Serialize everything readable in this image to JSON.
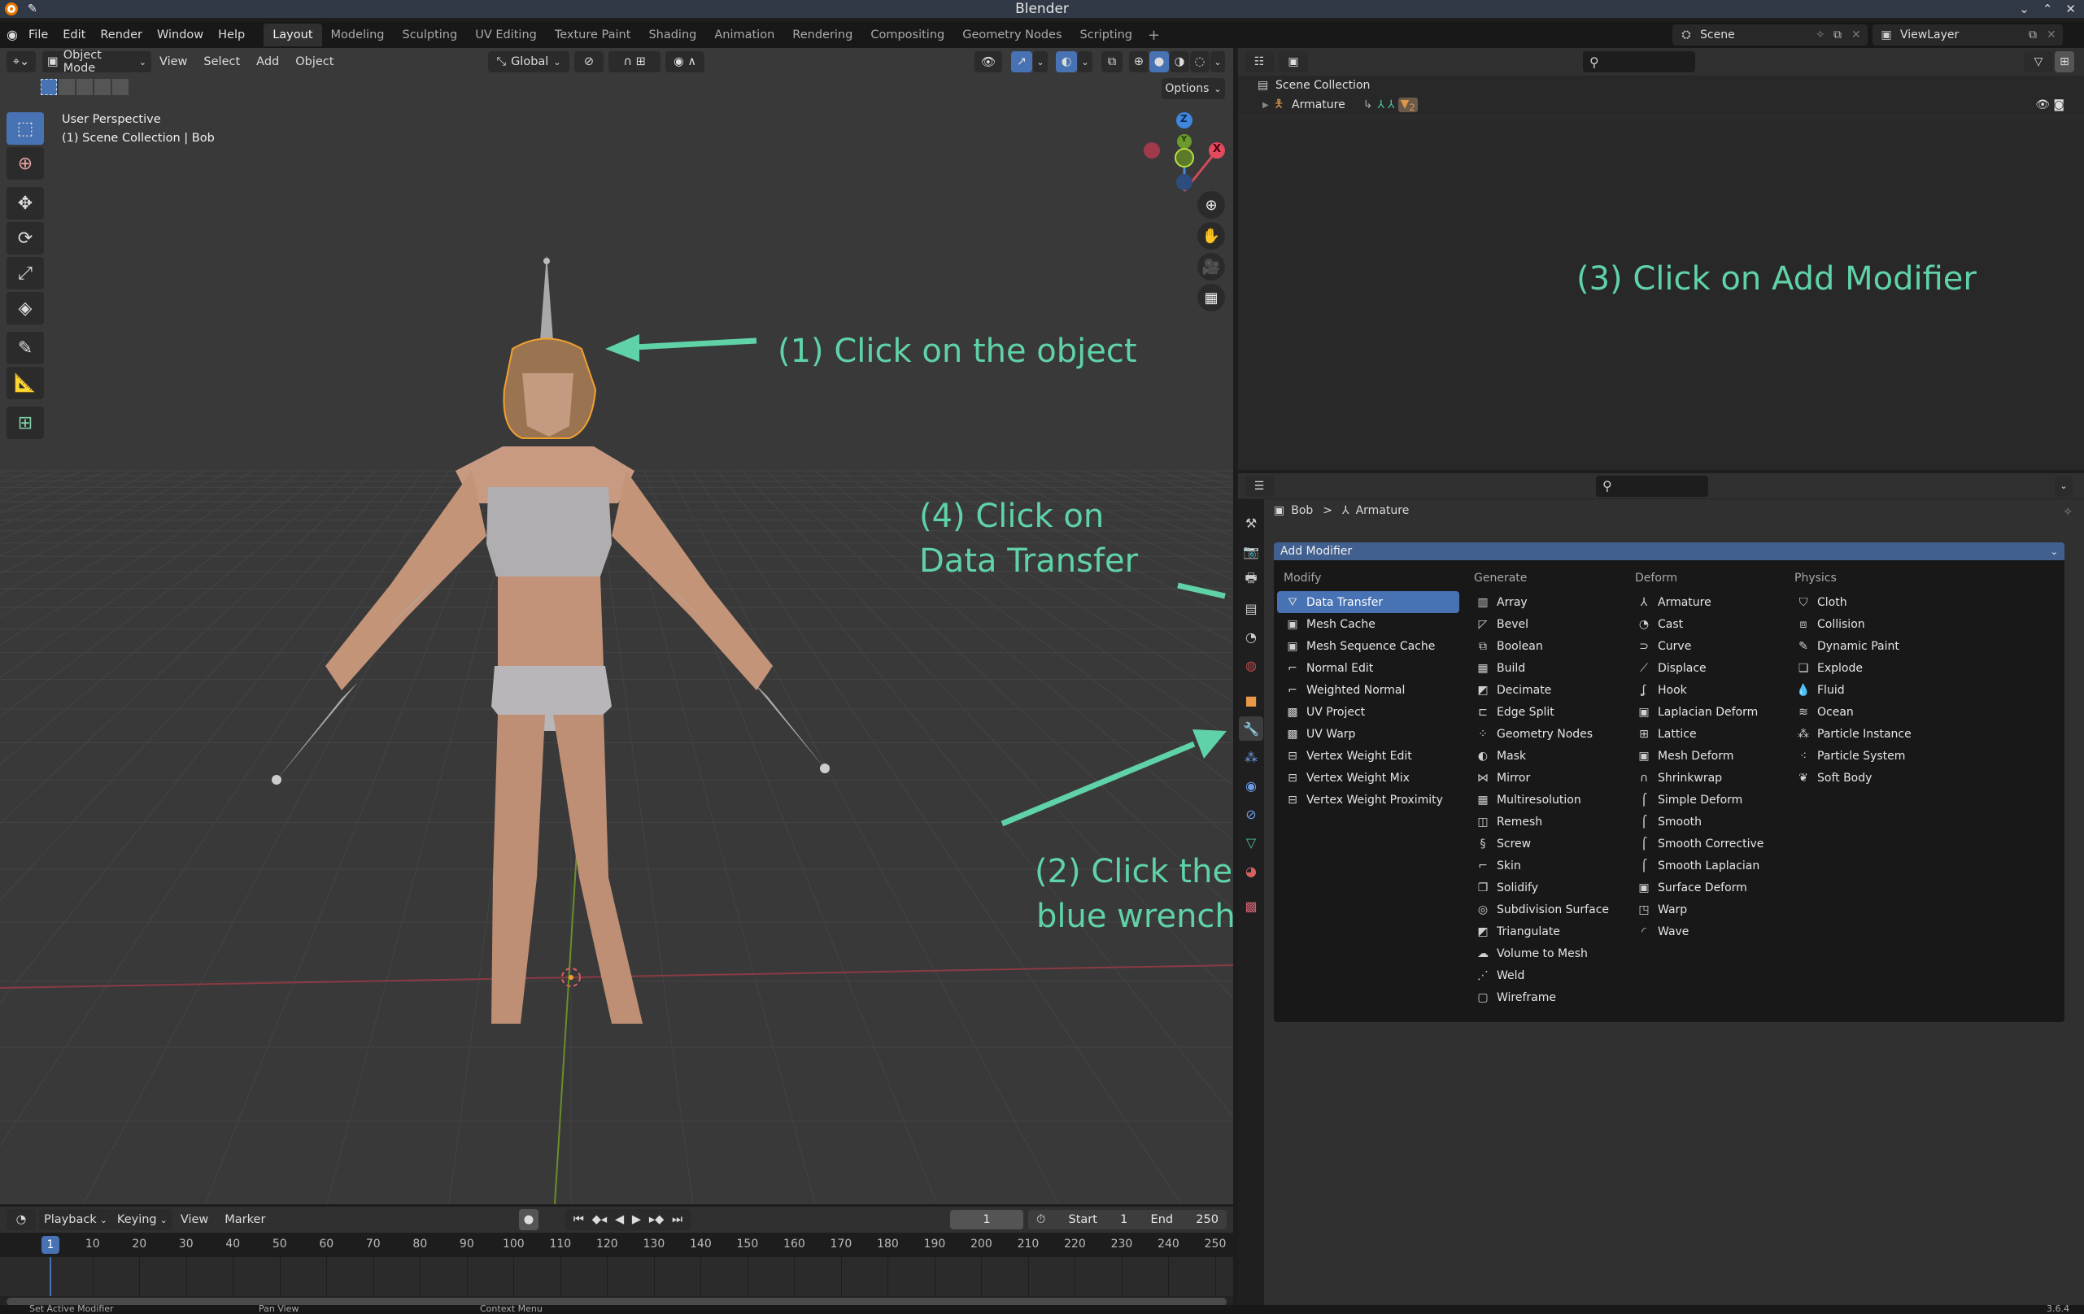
{
  "window": {
    "title": "Blender",
    "controls": [
      "⌄",
      "⌃",
      "✕"
    ]
  },
  "menubar": {
    "menus": [
      "File",
      "Edit",
      "Render",
      "Window",
      "Help"
    ],
    "workspaces": [
      "Layout",
      "Modeling",
      "Sculpting",
      "UV Editing",
      "Texture Paint",
      "Shading",
      "Animation",
      "Rendering",
      "Compositing",
      "Geometry Nodes",
      "Scripting"
    ],
    "active_workspace": "Layout",
    "add_workspace": "+",
    "scene": "Scene",
    "view_layer": "ViewLayer"
  },
  "viewport": {
    "mode": "Object Mode",
    "menus": [
      "View",
      "Select",
      "Add",
      "Object"
    ],
    "transform_orientation": "Global",
    "options_label": "Options",
    "info_line1": "User Perspective",
    "info_line2": "(1) Scene Collection | Bob",
    "gizmo": {
      "z": "Z",
      "y": "Y",
      "x": "X"
    },
    "tools": [
      "select-box",
      "cursor",
      "move",
      "rotate",
      "scale",
      "transform",
      "annotate",
      "measure",
      "add-cube"
    ],
    "nav_buttons": [
      "zoom",
      "pan",
      "camera",
      "perspective-grid"
    ]
  },
  "annotations": {
    "step1": "(1) Click on the object",
    "step2_line1": "(2) Click the",
    "step2_line2": "blue wrench",
    "step3": "(3) Click on Add Modifier",
    "step4_line1": "(4) Click on",
    "step4_line2": "Data Transfer",
    "color": "#5fd3a7"
  },
  "outliner": {
    "root": "Scene Collection",
    "items": [
      {
        "name": "Armature",
        "badge": "2"
      }
    ]
  },
  "properties": {
    "breadcrumb_object": "Bob",
    "breadcrumb_sep": ">",
    "breadcrumb_data": "Armature",
    "add_modifier_label": "Add Modifier",
    "columns": [
      {
        "header": "Modify",
        "items": [
          "Data Transfer",
          "Mesh Cache",
          "Mesh Sequence Cache",
          "Normal Edit",
          "Weighted Normal",
          "UV Project",
          "UV Warp",
          "Vertex Weight Edit",
          "Vertex Weight Mix",
          "Vertex Weight Proximity"
        ]
      },
      {
        "header": "Generate",
        "items": [
          "Array",
          "Bevel",
          "Boolean",
          "Build",
          "Decimate",
          "Edge Split",
          "Geometry Nodes",
          "Mask",
          "Mirror",
          "Multiresolution",
          "Remesh",
          "Screw",
          "Skin",
          "Solidify",
          "Subdivision Surface",
          "Triangulate",
          "Volume to Mesh",
          "Weld",
          "Wireframe"
        ]
      },
      {
        "header": "Deform",
        "items": [
          "Armature",
          "Cast",
          "Curve",
          "Displace",
          "Hook",
          "Laplacian Deform",
          "Lattice",
          "Mesh Deform",
          "Shrinkwrap",
          "Simple Deform",
          "Smooth",
          "Smooth Corrective",
          "Smooth Laplacian",
          "Surface Deform",
          "Warp",
          "Wave"
        ]
      },
      {
        "header": "Physics",
        "items": [
          "Cloth",
          "Collision",
          "Dynamic Paint",
          "Explode",
          "Fluid",
          "Ocean",
          "Particle Instance",
          "Particle System",
          "Soft Body"
        ]
      }
    ],
    "highlighted_item": "Data Transfer",
    "tabs": [
      "tool",
      "render",
      "output",
      "view-layer",
      "scene",
      "world",
      "object",
      "modifiers",
      "particles",
      "physics",
      "constraints",
      "data",
      "material",
      "texture"
    ],
    "active_tab": "modifiers"
  },
  "timeline": {
    "menus": [
      "Playback",
      "Keying",
      "View",
      "Marker"
    ],
    "current_frame": "1",
    "start_label": "Start",
    "start": "1",
    "end_label": "End",
    "end": "250",
    "ruler": [
      "10",
      "20",
      "30",
      "40",
      "50",
      "60",
      "70",
      "80",
      "90",
      "100",
      "110",
      "120",
      "130",
      "140",
      "150",
      "160",
      "170",
      "180",
      "190",
      "200",
      "210",
      "220",
      "230",
      "240",
      "250"
    ],
    "playhead": "1"
  },
  "statusbar": {
    "left": "Set Active Modifier",
    "middle": "Pan View",
    "right": "Context Menu",
    "version": "3.6.4"
  }
}
